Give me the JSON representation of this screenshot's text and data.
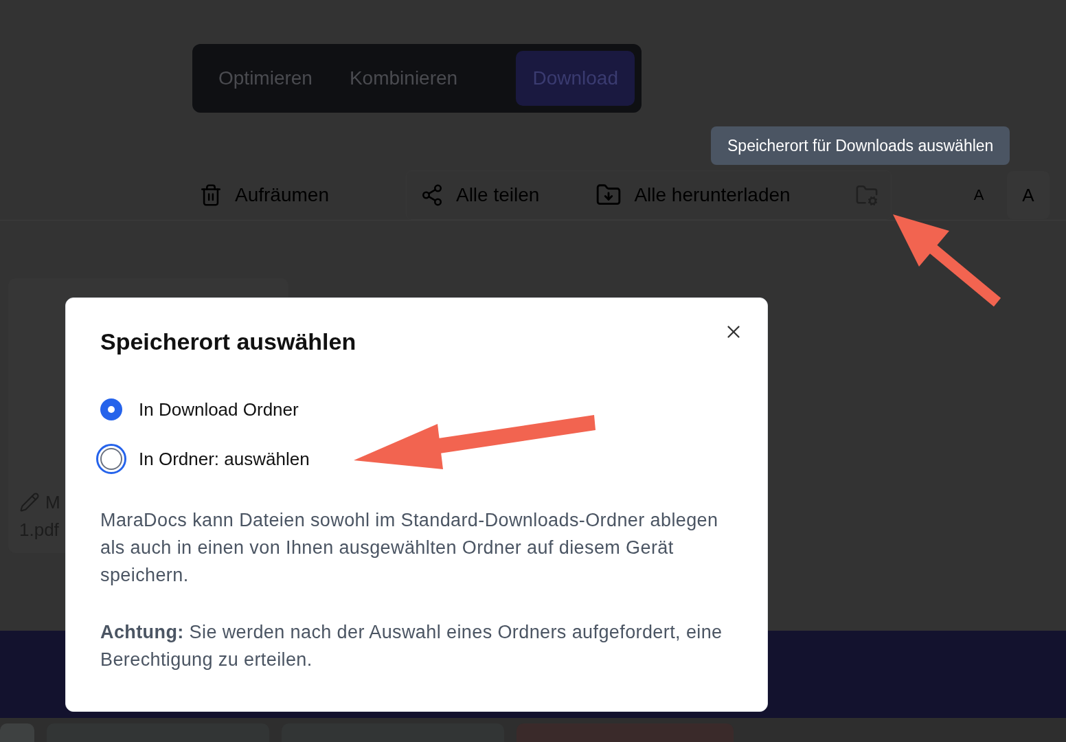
{
  "tabs": [
    {
      "label": "Optimieren",
      "selected": false
    },
    {
      "label": "Kombinieren",
      "selected": false
    },
    {
      "label": "Download",
      "selected": true
    }
  ],
  "tooltip": "Speicherort für Downloads auswählen",
  "toolbar": {
    "clear": "Aufräumen",
    "share_all": "Alle teilen",
    "download_all": "Alle herunterladen",
    "font_small": "A",
    "font_large": "A"
  },
  "file_card": {
    "name_lines": [
      "M",
      "1.pdf"
    ]
  },
  "dialog": {
    "title": "Speicherort auswählen",
    "options": [
      {
        "label": "In Download Ordner",
        "selected": true,
        "focused": false
      },
      {
        "label": "In Ordner: auswählen",
        "selected": false,
        "focused": true
      }
    ],
    "description": "MaraDocs kann Dateien sowohl im Standard-Downloads-Ordner ablegen als auch in einen von Ihnen ausgewählten Ordner auf diesem Gerät speichern.",
    "warning": "**Achtung:** Sie werden nach der Auswahl eines Ordners aufgefordert, eine Berechtigung zu erteilen."
  }
}
